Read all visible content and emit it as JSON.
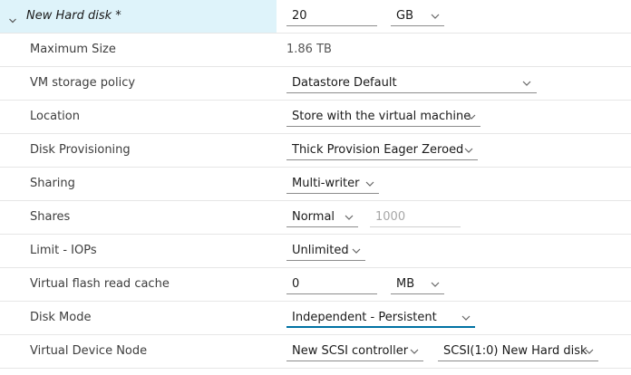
{
  "header": {
    "title": "New Hard disk *",
    "size_value": "20",
    "size_unit": "GB"
  },
  "rows": {
    "max_size": {
      "label": "Maximum Size",
      "value": "1.86 TB"
    },
    "storage_policy": {
      "label": "VM storage policy",
      "value": "Datastore Default"
    },
    "location": {
      "label": "Location",
      "value": "Store with the virtual machine"
    },
    "provisioning": {
      "label": "Disk Provisioning",
      "value": "Thick Provision Eager Zeroed"
    },
    "sharing": {
      "label": "Sharing",
      "value": "Multi-writer"
    },
    "shares": {
      "label": "Shares",
      "value": "Normal",
      "number_placeholder": "1000"
    },
    "limit_iops": {
      "label": "Limit - IOPs",
      "value": "Unlimited"
    },
    "flash_cache": {
      "label": "Virtual flash read cache",
      "value": "0",
      "unit": "MB"
    },
    "disk_mode": {
      "label": "Disk Mode",
      "value": "Independent - Persistent"
    },
    "device_node": {
      "label": "Virtual Device Node",
      "controller": "New SCSI controller",
      "node": "SCSI(1:0) New Hard disk"
    }
  },
  "icons": {
    "expander": "chevron-down-icon",
    "dropdown": "chevron-down-icon"
  },
  "colors": {
    "header_bg": "#def3fa",
    "focus_underline": "#0072a3"
  }
}
